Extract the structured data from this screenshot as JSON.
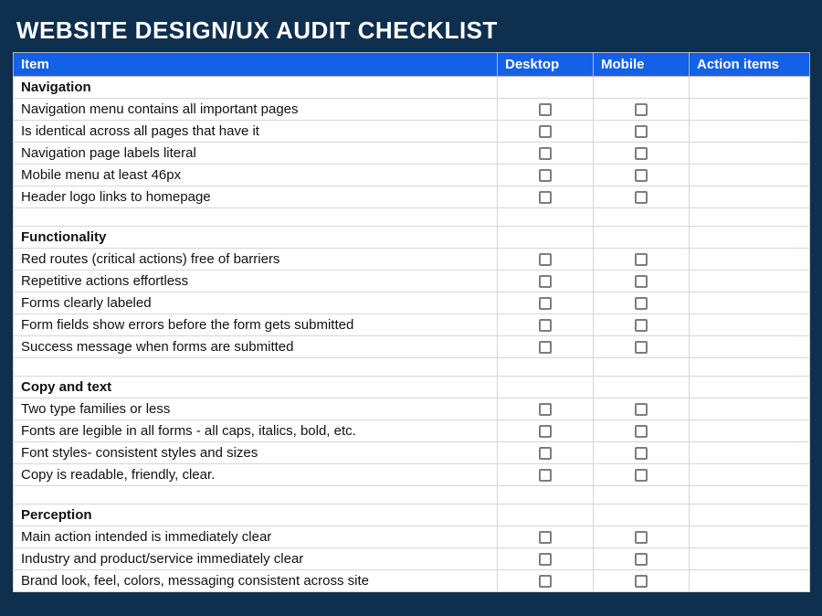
{
  "title": "WEBSITE DESIGN/UX AUDIT CHECKLIST",
  "columns": {
    "item": "Item",
    "desktop": "Desktop",
    "mobile": "Mobile",
    "action": "Action items"
  },
  "sections": [
    {
      "heading": "Navigation",
      "rows": [
        "Navigation menu contains all important pages",
        "Is identical across all pages that have it",
        "Navigation page labels literal",
        "Mobile menu at least 46px",
        "Header logo links to homepage"
      ]
    },
    {
      "heading": "Functionality",
      "rows": [
        "Red routes (critical actions) free of barriers",
        "Repetitive actions effortless",
        "Forms clearly labeled",
        "Form fields show errors before the form gets submitted",
        "Success message when forms are submitted"
      ]
    },
    {
      "heading": "Copy and text",
      "rows": [
        "Two type families or less",
        "Fonts are legible in all forms - all caps, italics, bold, etc.",
        "Font styles- consistent styles and sizes",
        "Copy is readable, friendly, clear."
      ]
    },
    {
      "heading": "Perception",
      "rows": [
        "Main action intended is immediately clear",
        "Industry and product/service immediately clear",
        "Brand look, feel, colors, messaging consistent across site"
      ]
    }
  ]
}
